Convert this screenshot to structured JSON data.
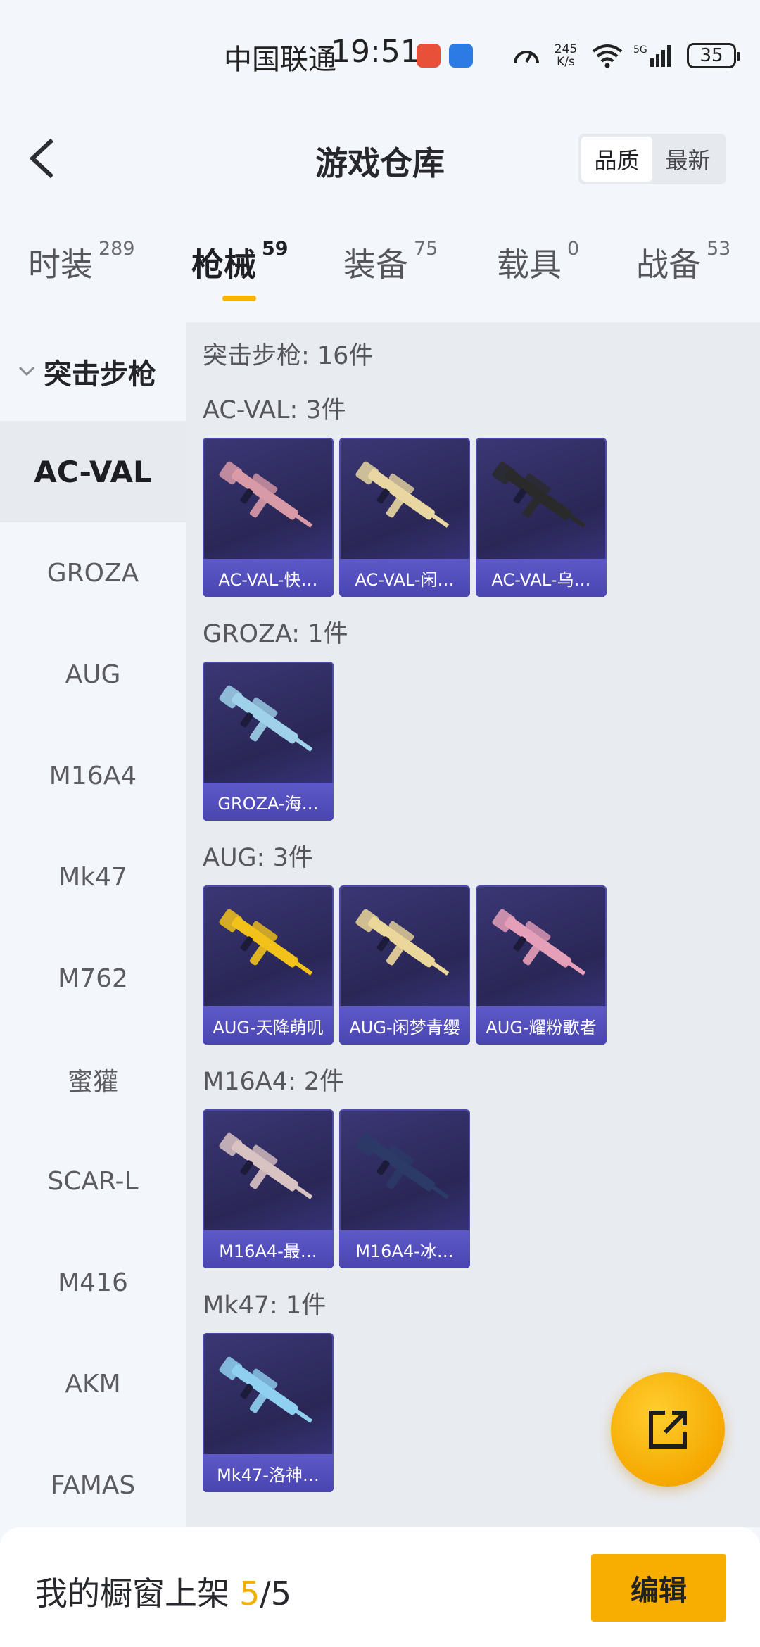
{
  "status_bar": {
    "carrier": "中国联通",
    "time": "19:51",
    "net_speed_value": "245",
    "net_speed_unit": "K/s",
    "wifi_label": "6",
    "signal_label": "5G",
    "battery": "35"
  },
  "header": {
    "title": "游戏仓库",
    "sort_options": [
      "品质",
      "最新"
    ],
    "active_sort": "品质"
  },
  "tabs": [
    {
      "label": "时装",
      "count": "289"
    },
    {
      "label": "枪械",
      "count": "59"
    },
    {
      "label": "装备",
      "count": "75"
    },
    {
      "label": "载具",
      "count": "0"
    },
    {
      "label": "战备",
      "count": "53"
    }
  ],
  "active_tab": "枪械",
  "sidebar": {
    "group_label": "突击步枪",
    "items": [
      "AC-VAL",
      "GROZA",
      "AUG",
      "M16A4",
      "Mk47",
      "M762",
      "蜜獾",
      "SCAR-L",
      "M416",
      "AKM",
      "FAMAS"
    ],
    "active_item": "AC-VAL"
  },
  "content": {
    "summary": "突击步枪: 16件",
    "groups": [
      {
        "title": "AC-VAL: 3件",
        "items": [
          "AC-VAL-快…",
          "AC-VAL-闲…",
          "AC-VAL-乌…"
        ]
      },
      {
        "title": "GROZA: 1件",
        "items": [
          "GROZA-海…"
        ]
      },
      {
        "title": "AUG: 3件",
        "items": [
          "AUG-天降萌叽",
          "AUG-闲梦青缨",
          "AUG-耀粉歌者"
        ]
      },
      {
        "title": "M16A4: 2件",
        "items": [
          "M16A4-最…",
          "M16A4-冰…"
        ]
      },
      {
        "title": "Mk47: 1件",
        "items": [
          "Mk47-洛神…"
        ]
      }
    ]
  },
  "bottom_bar": {
    "showcase_label": "我的橱窗上架",
    "showcase_current": "5",
    "showcase_slash": "/",
    "showcase_total": "5",
    "edit_label": "编辑"
  },
  "colors": {
    "accent": "#f5b400",
    "card_background": "#2f2b66",
    "card_label": "#5d59c8",
    "gun_colors": [
      "#d99aa8",
      "#e8d7a0",
      "#2a2a2a",
      "#9fd2ea",
      "#f2c21b",
      "#ecd79a",
      "#e59fb8",
      "#d9c2c2",
      "#2b3a66",
      "#8fd0f0"
    ]
  }
}
